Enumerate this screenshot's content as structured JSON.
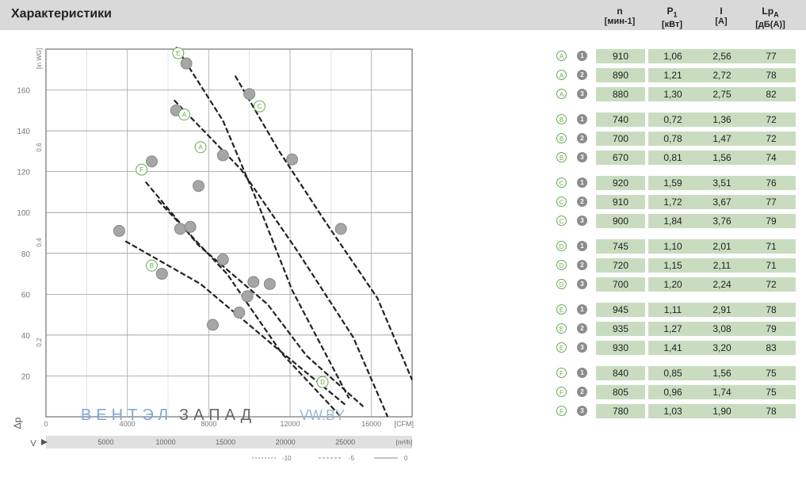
{
  "header": {
    "title": "Характеристики",
    "columns": [
      {
        "name": "n",
        "sub": "",
        "unit": "[мин-1]"
      },
      {
        "name": "P",
        "sub": "1",
        "unit": "[кВт]"
      },
      {
        "name": "I",
        "sub": "",
        "unit": "[A]"
      },
      {
        "name": "Lp",
        "sub": "A",
        "unit": "[дБ(A)]"
      }
    ]
  },
  "table": {
    "rows": [
      {
        "curve": "A",
        "mode": "1",
        "values": [
          "910",
          "1,06",
          "2,56",
          "77"
        ]
      },
      {
        "curve": "A",
        "mode": "2",
        "values": [
          "890",
          "1,21",
          "2,72",
          "78"
        ]
      },
      {
        "curve": "A",
        "mode": "3",
        "values": [
          "880",
          "1,30",
          "2,75",
          "82"
        ]
      },
      {
        "curve": "B",
        "mode": "1",
        "values": [
          "740",
          "0,72",
          "1,36",
          "72"
        ]
      },
      {
        "curve": "B",
        "mode": "2",
        "values": [
          "700",
          "0,78",
          "1,47",
          "72"
        ]
      },
      {
        "curve": "B",
        "mode": "3",
        "values": [
          "670",
          "0,81",
          "1,56",
          "74"
        ]
      },
      {
        "curve": "C",
        "mode": "1",
        "values": [
          "920",
          "1,59",
          "3,51",
          "76"
        ]
      },
      {
        "curve": "C",
        "mode": "2",
        "values": [
          "910",
          "1,72",
          "3,67",
          "77"
        ]
      },
      {
        "curve": "C",
        "mode": "3",
        "values": [
          "900",
          "1,84",
          "3,76",
          "79"
        ]
      },
      {
        "curve": "D",
        "mode": "1",
        "values": [
          "745",
          "1,10",
          "2,01",
          "71"
        ]
      },
      {
        "curve": "D",
        "mode": "2",
        "values": [
          "720",
          "1,15",
          "2,11",
          "71"
        ]
      },
      {
        "curve": "D",
        "mode": "3",
        "values": [
          "700",
          "1,20",
          "2,24",
          "72"
        ]
      },
      {
        "curve": "E",
        "mode": "1",
        "values": [
          "945",
          "1,11",
          "2,91",
          "78"
        ]
      },
      {
        "curve": "E",
        "mode": "2",
        "values": [
          "935",
          "1,27",
          "3,08",
          "79"
        ]
      },
      {
        "curve": "E",
        "mode": "3",
        "values": [
          "930",
          "1,41",
          "3,20",
          "83"
        ]
      },
      {
        "curve": "F",
        "mode": "1",
        "values": [
          "840",
          "0,85",
          "1,56",
          "75"
        ]
      },
      {
        "curve": "F",
        "mode": "2",
        "values": [
          "805",
          "0,96",
          "1,74",
          "75"
        ]
      },
      {
        "curve": "F",
        "mode": "3",
        "values": [
          "780",
          "1,03",
          "1,90",
          "78"
        ]
      }
    ]
  },
  "watermark": {
    "text": "ВЕНТЭЛ",
    "text2": "ЗАПАД",
    "text3": "VW.BY"
  },
  "chart_data": {
    "type": "line",
    "grid": true,
    "axis_symbol_y": "Δp",
    "axis_symbol_x": "V",
    "y_unit": "[in WG]",
    "y_ticks": [
      20,
      40,
      60,
      80,
      100,
      120,
      140,
      160
    ],
    "y_lim": [
      0,
      180
    ],
    "x_ticks_top": [
      "0",
      "4000",
      "8000",
      "12000",
      "16000"
    ],
    "x_unit_top": "[CFM]",
    "x_ticks_bottom": [
      "5000",
      "10000",
      "15000",
      "20000",
      "25000"
    ],
    "x_unit_bottom": "[m³/h]",
    "x_lim_cfm": [
      0,
      18000
    ],
    "right_axis_ticks": [
      "0,6",
      "0,4",
      "0,2"
    ],
    "footer_legend": [
      "-10",
      "-5",
      "0"
    ],
    "series": [
      {
        "name": "A",
        "points": [
          [
            6300,
            155
          ],
          [
            9600,
            121
          ],
          [
            12300,
            82
          ],
          [
            15100,
            39
          ],
          [
            16800,
            0
          ]
        ]
      },
      {
        "name": "B",
        "points": [
          [
            3900,
            86
          ],
          [
            7600,
            65
          ],
          [
            11300,
            34
          ],
          [
            14700,
            6
          ]
        ]
      },
      {
        "name": "C",
        "points": [
          [
            9300,
            167
          ],
          [
            11400,
            131
          ],
          [
            13700,
            96
          ],
          [
            16300,
            58
          ],
          [
            18000,
            18
          ]
        ]
      },
      {
        "name": "D",
        "points": [
          [
            5500,
            106
          ],
          [
            8900,
            70
          ],
          [
            11600,
            31
          ],
          [
            14500,
            0
          ]
        ]
      },
      {
        "name": "E",
        "points": [
          [
            6400,
            181
          ],
          [
            8700,
            145
          ],
          [
            10400,
            105
          ],
          [
            12100,
            62
          ],
          [
            14900,
            9
          ]
        ]
      },
      {
        "name": "F",
        "points": [
          [
            4900,
            115
          ],
          [
            7500,
            84
          ],
          [
            10900,
            55
          ],
          [
            12800,
            30
          ],
          [
            15600,
            5
          ]
        ]
      }
    ],
    "markers": [
      {
        "label": "E",
        "x": 6500,
        "y": 178
      },
      {
        "label": "A",
        "x": 6800,
        "y": 148
      },
      {
        "label": "F",
        "x": 4700,
        "y": 121
      },
      {
        "label": "A",
        "x": 7600,
        "y": 132
      },
      {
        "label": "C",
        "x": 10500,
        "y": 152
      },
      {
        "label": "B",
        "x": 5200,
        "y": 74
      },
      {
        "label": "D",
        "x": 13600,
        "y": 17
      }
    ],
    "points": [
      [
        6900,
        173
      ],
      [
        6400,
        150
      ],
      [
        5200,
        125
      ],
      [
        10000,
        158
      ],
      [
        8700,
        128
      ],
      [
        7500,
        113
      ],
      [
        12100,
        126
      ],
      [
        14500,
        92
      ],
      [
        6600,
        92
      ],
      [
        3600,
        91
      ],
      [
        7100,
        93
      ],
      [
        8700,
        77
      ],
      [
        5700,
        70
      ],
      [
        10200,
        66
      ],
      [
        11000,
        65
      ],
      [
        9900,
        59
      ],
      [
        8200,
        45
      ],
      [
        9500,
        51
      ]
    ]
  }
}
